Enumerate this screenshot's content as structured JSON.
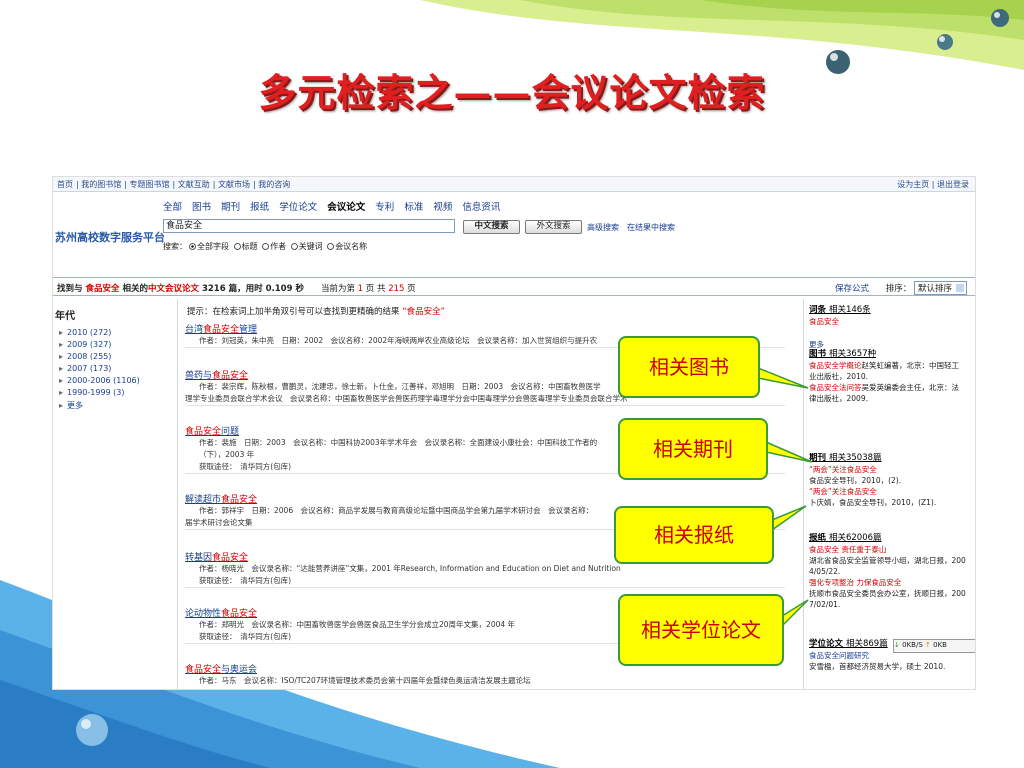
{
  "slide": {
    "title": "多元检索之——会议论文检索"
  },
  "toplinks": [
    "首页",
    "我的图书馆",
    "专题图书馆",
    "文献互助",
    "文献市场",
    "我的咨询"
  ],
  "toplinks_right": [
    "设为主页",
    "退出登录"
  ],
  "brand": "苏州高校数字服务平台",
  "categories": [
    "全部",
    "图书",
    "期刊",
    "报纸",
    "学位论文",
    "会议论文",
    "专利",
    "标准",
    "视频",
    "信息资讯"
  ],
  "active_category": "会议论文",
  "search": {
    "value": "食品安全",
    "btn_cn": "中文搜索",
    "btn_foreign": "外文搜索",
    "adv": "高级搜索",
    "within": "在结果中搜索"
  },
  "scope": {
    "label": "搜索：",
    "options": [
      "全部字段",
      "标题",
      "作者",
      "关键词",
      "会议名称"
    ],
    "selected": "全部字段"
  },
  "resultbar": {
    "p1": "找到与",
    "kw": "食品安全",
    "p2": "相关的",
    "type": "中文会议论文",
    "count": "3216",
    "p3": "篇，用时",
    "time": "0.109",
    "p4": "秒",
    "pg1": "当前为第",
    "page": "1",
    "pg2": "页 共",
    "total": "215",
    "pg3": "页",
    "save": "保存公式",
    "sort_label": "排序：",
    "sort_value": "默认排序"
  },
  "years": {
    "title": "年代",
    "items": [
      "2010 (272)",
      "2009 (327)",
      "2008 (255)",
      "2007 (173)",
      "2000-2006 (1106)",
      "1990-1999 (3)",
      "更多"
    ]
  },
  "tip": {
    "text": "提示：在检索词上加半角双引号可以查找到更精确的结果",
    "example": "“食品安全”"
  },
  "results": [
    {
      "title_pre": "台湾",
      "hl": "食品安全",
      "title_post": "管理",
      "meta": [
        "作者：刘冠英，朱中亮　日期：2002　会议名称：2002年海峡两岸农业高级论坛　会议录名称：加入世贸组织与提升农"
      ]
    },
    {
      "title_pre": "兽药与",
      "hl": "食品安全",
      "title_post": "",
      "meta": [
        "作者：裴宗辉，陈秋根，曹鹏灵，沈建忠，徐士新，卜仕金，江善祥，邓旭明　日期：2003　会议名称：中国畜牧兽医学",
        "理学专业委员会联合学术会议　会议录名称：中国畜牧兽医学会兽医药理学毒理学分会中国毒理学分会兽医毒理学专业委员会联合学术"
      ]
    },
    {
      "title_pre": "",
      "hl": "食品安全",
      "title_post": "问题",
      "meta": [
        "作者：裴施　日期：2003　会议名称：中国科协2003年学术年会　会议录名称：全面建设小康社会：中国科技工作者的",
        "（下），2003 年",
        "获取途径：　清华同方(包库)"
      ]
    },
    {
      "title_pre": "解读超市",
      "hl": "食品安全",
      "title_post": "",
      "meta": [
        "作者：郭祥宇　日期：2006　会议名称：商品学发展与教育高级论坛暨中国商品学会第九届学术研讨会　会议录名称：",
        "届学术研讨会论文集"
      ]
    },
    {
      "title_pre": "转基因",
      "hl": "食品安全",
      "title_post": "",
      "meta": [
        "作者：杨晓光　会议录名称：“达能营养讲座”文集，2001 年Research, Information and Education on Diet and Nutrition",
        "获取途径：　清华同方(包库)"
      ]
    },
    {
      "title_pre": "论动物性",
      "hl": "食品安全",
      "title_post": "",
      "meta": [
        "作者：郑明光　会议录名称：中国畜牧兽医学会兽医食品卫生学分会成立20周年文集，2004 年",
        "获取途径：　清华同方(包库)"
      ]
    },
    {
      "title_pre": "",
      "hl": "食品安全",
      "title_post": "与奥运会",
      "meta": [
        "作者：马东　会议名称：ISO/TC207环境管理技术委员会第十四届年会暨绿色奥运清洁发展主题论坛"
      ]
    }
  ],
  "sidebar": {
    "ci_title": "词条",
    "ci_count": "相关146条",
    "ci_item": "食品安全",
    "more": "更多",
    "book_title": "图书",
    "book_count": "相关3657种",
    "book_1": "食品安全学概论",
    "book_1b": "赵笑虹编著，北京：中国轻工",
    "book_1c": "业出版社，2010.",
    "book_2": "食品安全法问答",
    "book_2b": "吴爱英编委会主任，北京：法",
    "book_2c": "律出版社，2009.",
    "journal_title": "期刊",
    "journal_count": "相关35038篇",
    "j1": "“两会”关注食品安全",
    "j1b": "食品安全导刊，2010，(2).",
    "j2": "“两会”关注食品安全",
    "j2b": "卜庆婧，食品安全导刊，2010，(Z1).",
    "news_title": "报纸",
    "news_count": "相关62006篇",
    "n1": "食品安全 责任重于泰山",
    "n1b": "湖北省食品安全监管领导小组，湖北日报，200",
    "n1c": "4/05/22.",
    "n2": "强化专项整治 力保食品安全",
    "n2b": "抚顺市食品安全委员会办公室，抚顺日报，200",
    "n2c": "7/02/01.",
    "degree_title": "学位论文",
    "degree_count": "相关869篇",
    "d1": "食品安全问题研究",
    "d1b": "安雪楹，首都经济贸易大学，硕士 2010.",
    "dl_down": "0KB/S",
    "dl_up": "0KB"
  },
  "callouts": [
    "相关图书",
    "相关期刊",
    "相关报纸",
    "相关学位论文"
  ]
}
